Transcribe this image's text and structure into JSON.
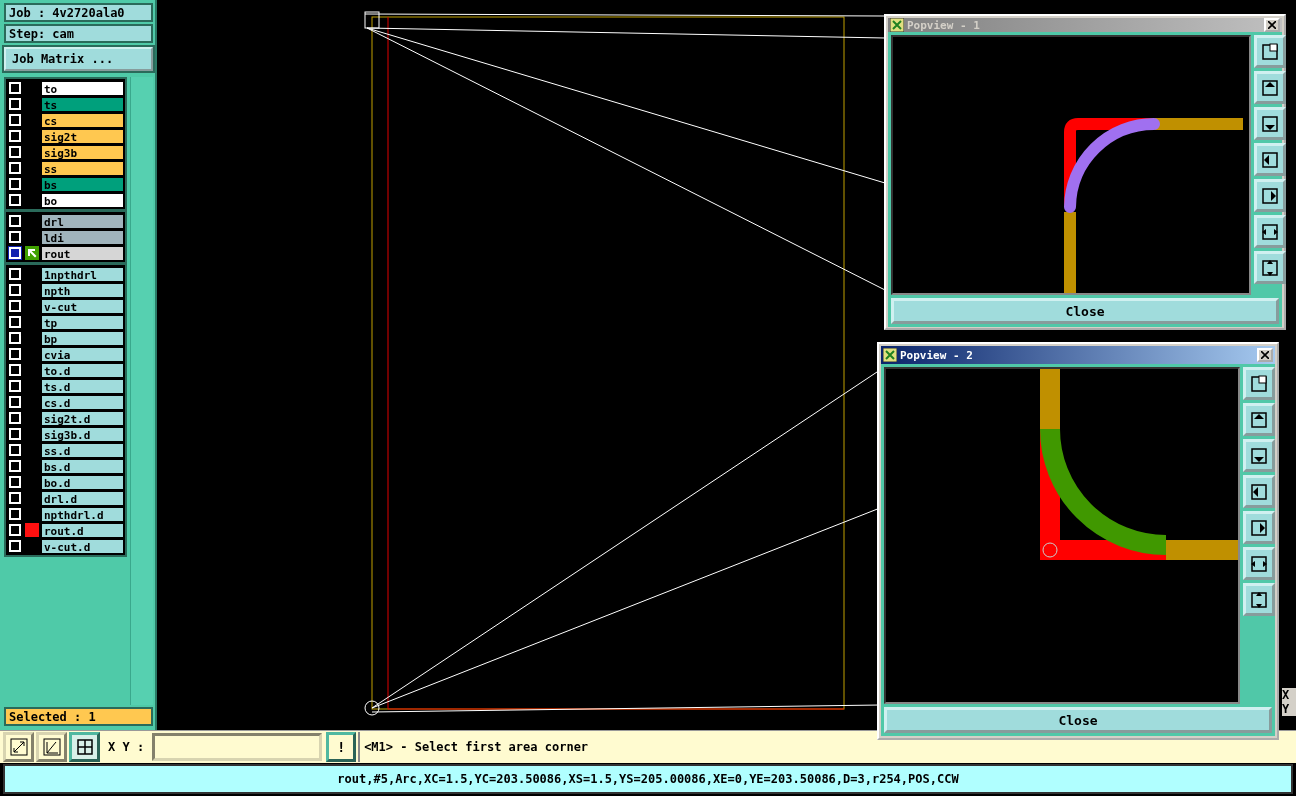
{
  "job": {
    "label": "Job : 4v2720ala0"
  },
  "step": {
    "label": "Step: cam"
  },
  "job_matrix_button": "Job Matrix ...",
  "layer_groups": [
    {
      "layers": [
        {
          "name": "to",
          "color": "#ffffff",
          "checked": false,
          "work": false,
          "displayed": false
        },
        {
          "name": "ts",
          "color": "#00a07c",
          "checked": false,
          "work": false,
          "displayed": false
        },
        {
          "name": "cs",
          "color": "#ffc850",
          "checked": false,
          "work": false,
          "displayed": false
        },
        {
          "name": "sig2t",
          "color": "#ffc850",
          "checked": false,
          "work": false,
          "displayed": false
        },
        {
          "name": "sig3b",
          "color": "#ffc850",
          "checked": false,
          "work": false,
          "displayed": false
        },
        {
          "name": "ss",
          "color": "#ffc850",
          "checked": false,
          "work": false,
          "displayed": false
        },
        {
          "name": "bs",
          "color": "#00a07c",
          "checked": false,
          "work": false,
          "displayed": false
        },
        {
          "name": "bo",
          "color": "#ffffff",
          "checked": false,
          "work": false,
          "displayed": false
        }
      ]
    },
    {
      "layers": [
        {
          "name": "drl",
          "color": "#a0b4bc",
          "checked": false,
          "work": false,
          "displayed": false
        },
        {
          "name": "ldi",
          "color": "#a0b4bc",
          "checked": false,
          "work": false,
          "displayed": false
        },
        {
          "name": "rout",
          "color": "#d6d6d6",
          "checked": false,
          "work": true,
          "displayed": false
        }
      ]
    },
    {
      "layers": [
        {
          "name": "1npthdrl",
          "color": "#a0dcdc",
          "checked": false,
          "work": false,
          "displayed": false
        },
        {
          "name": "npth",
          "color": "#a0dcdc",
          "checked": false,
          "work": false,
          "displayed": false
        },
        {
          "name": "v-cut",
          "color": "#a0dcdc",
          "checked": false,
          "work": false,
          "displayed": false
        },
        {
          "name": "tp",
          "color": "#a0dcdc",
          "checked": false,
          "work": false,
          "displayed": false
        },
        {
          "name": "bp",
          "color": "#a0dcdc",
          "checked": false,
          "work": false,
          "displayed": false
        },
        {
          "name": "cvia",
          "color": "#a0dcdc",
          "checked": false,
          "work": false,
          "displayed": false
        },
        {
          "name": "to.d",
          "color": "#a0dcdc",
          "checked": false,
          "work": false,
          "displayed": false
        },
        {
          "name": "ts.d",
          "color": "#a0dcdc",
          "checked": false,
          "work": false,
          "displayed": false
        },
        {
          "name": "cs.d",
          "color": "#a0dcdc",
          "checked": false,
          "work": false,
          "displayed": false
        },
        {
          "name": "sig2t.d",
          "color": "#a0dcdc",
          "checked": false,
          "work": false,
          "displayed": false
        },
        {
          "name": "sig3b.d",
          "color": "#a0dcdc",
          "checked": false,
          "work": false,
          "displayed": false
        },
        {
          "name": "ss.d",
          "color": "#a0dcdc",
          "checked": false,
          "work": false,
          "displayed": false
        },
        {
          "name": "bs.d",
          "color": "#a0dcdc",
          "checked": false,
          "work": false,
          "displayed": false
        },
        {
          "name": "bo.d",
          "color": "#a0dcdc",
          "checked": false,
          "work": false,
          "displayed": false
        },
        {
          "name": "drl.d",
          "color": "#a0dcdc",
          "checked": false,
          "work": false,
          "displayed": false
        },
        {
          "name": "npthdrl.d",
          "color": "#a0dcdc",
          "checked": false,
          "work": false,
          "displayed": false
        },
        {
          "name": "rout.d",
          "color": "#a0dcdc",
          "checked": false,
          "work": false,
          "displayed": true
        },
        {
          "name": "v-cut.d",
          "color": "#a0dcdc",
          "checked": false,
          "work": false,
          "displayed": false
        }
      ]
    }
  ],
  "selected_count": "Selected : 1",
  "popviews": [
    {
      "title": "Popview - 1",
      "active": false,
      "close": "Close",
      "kind": "corner"
    },
    {
      "title": "Popview - 2",
      "active": true,
      "close": "Close",
      "kind": "arc"
    }
  ],
  "toolbar": {
    "buttons": [
      {
        "kind": "diagonal",
        "selected": false
      },
      {
        "kind": "angle",
        "selected": false
      },
      {
        "kind": "grid",
        "selected": true
      }
    ],
    "xy_label": "X Y :",
    "exec_button": "!",
    "prompt": "<M1> - Select first area corner"
  },
  "status_bar": "rout,#5,Arc,XC=1.5,YC=203.50086,XS=1.5,YS=205.00086,XE=0,YE=203.50086,D=3,r254,POS,CCW",
  "right_strip": {
    "labels": [
      "X",
      "Y"
    ]
  }
}
